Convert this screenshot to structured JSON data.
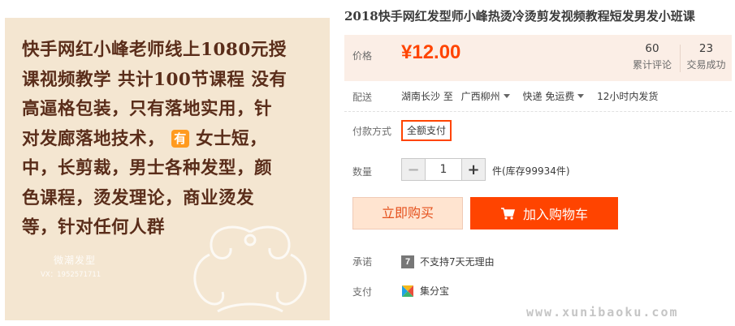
{
  "image_panel": {
    "lines": [
      "快手网红小峰老师线上1080元授",
      "课视频教学 共计100节课程  没有",
      "高逼格包装，只有落地实用，针",
      "对发廊落地技术，",
      "女士短，",
      "中，长剪裁，男士各种发型，颜",
      "色课程，烫发理论，商业烫发",
      "等，针对任何人群"
    ],
    "badge_char": "有",
    "watermark_title": "微潮发型",
    "watermark_sub": "VX：1952571711"
  },
  "product": {
    "title": "2018快手网红发型师小峰热烫冷烫剪发视频教程短发男发小班课"
  },
  "price": {
    "label": "价格",
    "value": "¥12.00",
    "reviews_count": "60",
    "reviews_label": "累计评论",
    "sold_count": "23",
    "sold_label": "交易成功"
  },
  "shipping": {
    "label": "配送",
    "from": "湖南长沙 至",
    "to": "广西柳州",
    "method": "快递 免运费",
    "time": "12小时内发货"
  },
  "payment": {
    "label": "付款方式",
    "option": "全额支付"
  },
  "quantity": {
    "label": "数量",
    "minus": "−",
    "value": "1",
    "plus": "+",
    "stock": "件(库存99934件)"
  },
  "actions": {
    "buy_now": "立即购买",
    "add_to_cart": "加入购物车"
  },
  "promise": {
    "label": "承诺",
    "icon_char": "7",
    "text": "不支持7天无理由"
  },
  "pay_service": {
    "label": "支付",
    "text": "集分宝"
  },
  "site_watermark": "www.xunibaoku.com",
  "colors": {
    "accent": "#ff4400",
    "price_bg": "#fbeee6",
    "buy_bg": "#ffe4d0",
    "image_bg": "#f4e6d1",
    "image_text": "#5a2d1a"
  }
}
